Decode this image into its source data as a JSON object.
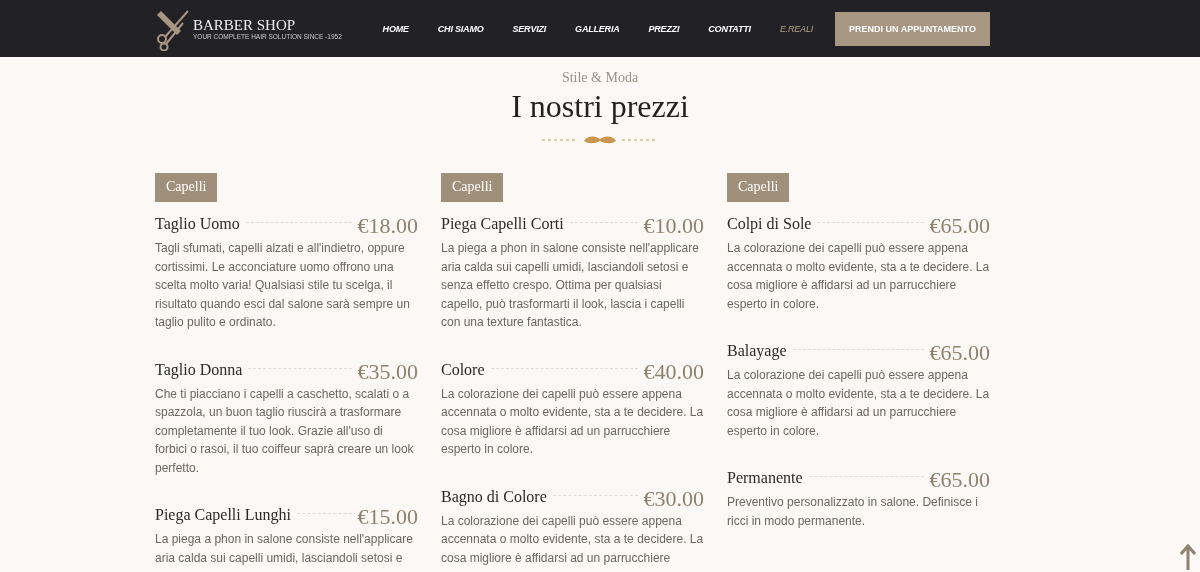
{
  "header": {
    "logo": {
      "title": "BARBER SHOP",
      "tagline": "YOUR COMPLETE HAIR SOLUTION SINCE -1952"
    },
    "nav": [
      {
        "label": "HOME",
        "selected": false
      },
      {
        "label": "CHI SIAMO",
        "selected": false
      },
      {
        "label": "SERVIZI",
        "selected": false
      },
      {
        "label": "GALLERIA",
        "selected": false
      },
      {
        "label": "PREZZI",
        "selected": false
      },
      {
        "label": "CONTATTI",
        "selected": false
      },
      {
        "label": "E.REALI",
        "selected": true
      }
    ],
    "cta": "PRENDI UN APPUNTAMENTO"
  },
  "section": {
    "subtitle": "Stile & Moda",
    "title": "I nostri prezzi"
  },
  "columns": [
    {
      "tag": "Capelli",
      "items": [
        {
          "name": "Taglio Uomo",
          "price": "€18.00",
          "description": "Tagli sfumati, capelli alzati e all'indietro, oppure cortissimi. Le acconciature uomo offrono una scelta molto varia! Qualsiasi stile tu scelga, il risultato quando esci dal salone sarà sempre un taglio pulito e ordinato."
        },
        {
          "name": "Taglio Donna",
          "price": "€35.00",
          "description": "Che ti piacciano i capelli a caschetto, scalati o a spazzola, un buon taglio riuscirà a trasformare completamente il tuo look. Grazie all'uso di forbici o rasoi, il tuo coiffeur saprà creare un look perfetto."
        },
        {
          "name": "Piega Capelli Lunghi",
          "price": "€15.00",
          "description": "La piega a phon in salone consiste nell'applicare aria calda sui capelli umidi, lasciandoli setosi e"
        }
      ]
    },
    {
      "tag": "Capelli",
      "items": [
        {
          "name": "Piega Capelli Corti",
          "price": "€10.00",
          "description": "La piega a phon in salone consiste nell'applicare aria calda sui capelli umidi, lasciandoli setosi e senza effetto crespo. Ottima per qualsiasi capello, può trasformarti il look, lascia i capelli con una texture fantastica."
        },
        {
          "name": "Colore",
          "price": "€40.00",
          "description": "La colorazione dei capelli può essere appena accennata o molto evidente, sta a te decidere. La cosa migliore è affidarsi ad un parrucchiere esperto in colore."
        },
        {
          "name": "Bagno di Colore",
          "price": "€30.00",
          "description": "La colorazione dei capelli può essere appena accennata o molto evidente, sta a te decidere. La cosa migliore è affidarsi ad un parrucchiere"
        }
      ]
    },
    {
      "tag": "Capelli",
      "items": [
        {
          "name": "Colpi di Sole",
          "price": "€65.00",
          "description": "La colorazione dei capelli può essere appena accennata o molto evidente, sta a te decidere. La cosa migliore è affidarsi ad un parrucchiere esperto in colore."
        },
        {
          "name": "Balayage",
          "price": "€65.00",
          "description": "La colorazione dei capelli può essere appena accennata o molto evidente, sta a te decidere. La cosa migliore è affidarsi ad un parrucchiere esperto in colore."
        },
        {
          "name": "Permanente",
          "price": "€65.00",
          "description": "Preventivo personalizzato in salone. Definisce i ricci in modo permanente."
        }
      ]
    }
  ]
}
